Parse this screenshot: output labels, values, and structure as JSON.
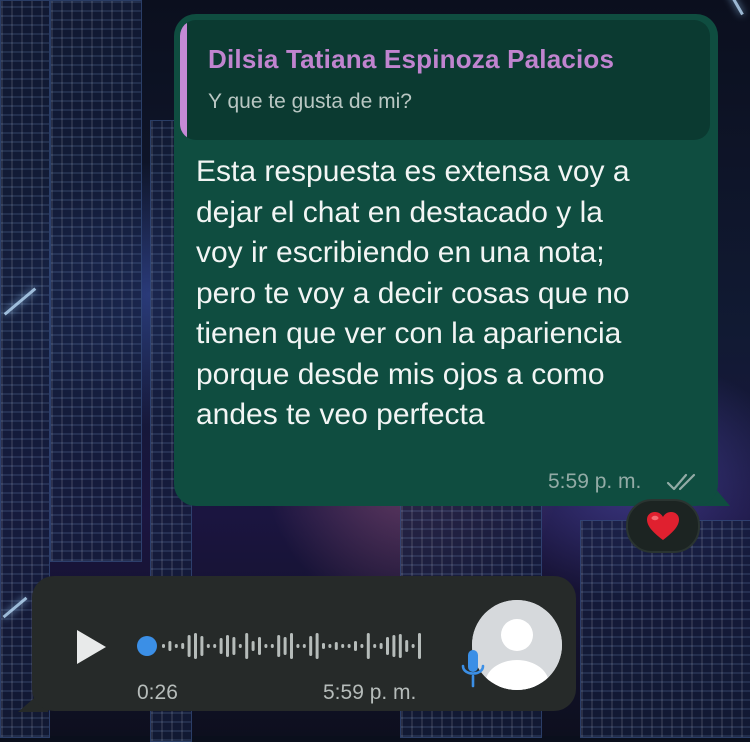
{
  "quoted": {
    "author": "Dilsia Tatiana Espinoza Palacios",
    "text": "Y que te gusta de mi?"
  },
  "message": {
    "lines": [
      "Esta respuesta es extensa voy a",
      "dejar el chat en destacado y la",
      "voy ir escribiendo en una nota;",
      "pero te voy a decir cosas que no",
      "tienen que ver con la apariencia",
      "porque desde mis ojos a como",
      "andes te veo perfecta"
    ],
    "time": "5:59 p. m.",
    "status_icon": "double-check-icon"
  },
  "reaction": {
    "emoji_icon": "red-heart-icon",
    "color": "#e0202f"
  },
  "voice_note": {
    "duration": "0:26",
    "time": "5:59 p. m.",
    "progress": 0.0,
    "play_icon": "play-icon",
    "mic_icon": "microphone-icon",
    "accent": "#3b8fe6"
  },
  "colors": {
    "outgoing_bubble": "#0f4d40",
    "incoming_bubble": "#262a29",
    "quote_author": "#c084cf"
  }
}
